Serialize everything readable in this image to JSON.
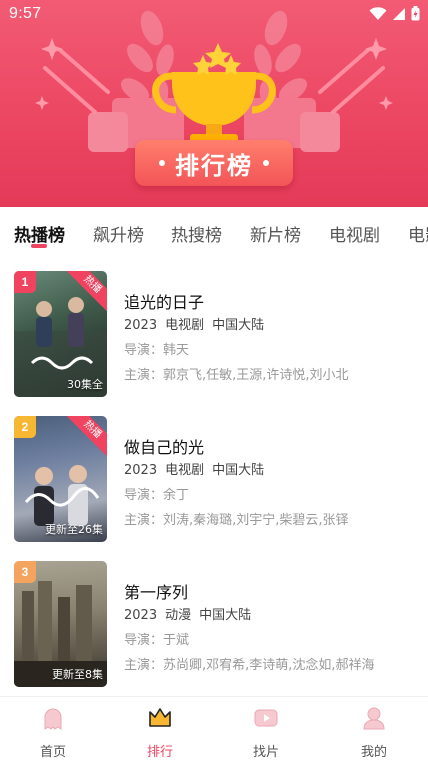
{
  "status_bar": {
    "time": "9:57"
  },
  "banner": {
    "title": "排行榜"
  },
  "tabs": [
    {
      "label": "热播榜",
      "active": true
    },
    {
      "label": "飙升榜",
      "active": false
    },
    {
      "label": "热搜榜",
      "active": false
    },
    {
      "label": "新片榜",
      "active": false
    },
    {
      "label": "电视剧",
      "active": false
    },
    {
      "label": "电影",
      "active": false
    }
  ],
  "items": [
    {
      "rank": "1",
      "rank_color": "#f0435f",
      "hot_tag": "热播",
      "episode_badge": "30集全",
      "title": "追光的日子",
      "year": "2023",
      "genre": "电视剧",
      "region": "中国大陆",
      "director": "导演：韩天",
      "cast": "主演：郭京飞,任敏,王源,许诗悦,刘小北"
    },
    {
      "rank": "2",
      "rank_color": "#f7b733",
      "hot_tag": "热播",
      "episode_badge": "更新至26集",
      "title": "做自己的光",
      "year": "2023",
      "genre": "电视剧",
      "region": "中国大陆",
      "director": "导演：余丁",
      "cast": "主演：刘涛,秦海璐,刘宇宁,柴碧云,张铎"
    },
    {
      "rank": "3",
      "rank_color": "#f4a45f",
      "hot_tag": "",
      "episode_badge": "更新至8集",
      "title": "第一序列",
      "year": "2023",
      "genre": "动漫",
      "region": "中国大陆",
      "director": "导演：于斌",
      "cast": "主演：苏尚卿,邓宥希,李诗萌,沈念如,郝祥海"
    }
  ],
  "bottom_nav": [
    {
      "label": "首页",
      "active": false
    },
    {
      "label": "排行",
      "active": true
    },
    {
      "label": "找片",
      "active": false
    },
    {
      "label": "我的",
      "active": false
    }
  ],
  "colors": {
    "accent": "#f0435f",
    "banner": "#ec4763",
    "trophy": "#ffc21a"
  }
}
